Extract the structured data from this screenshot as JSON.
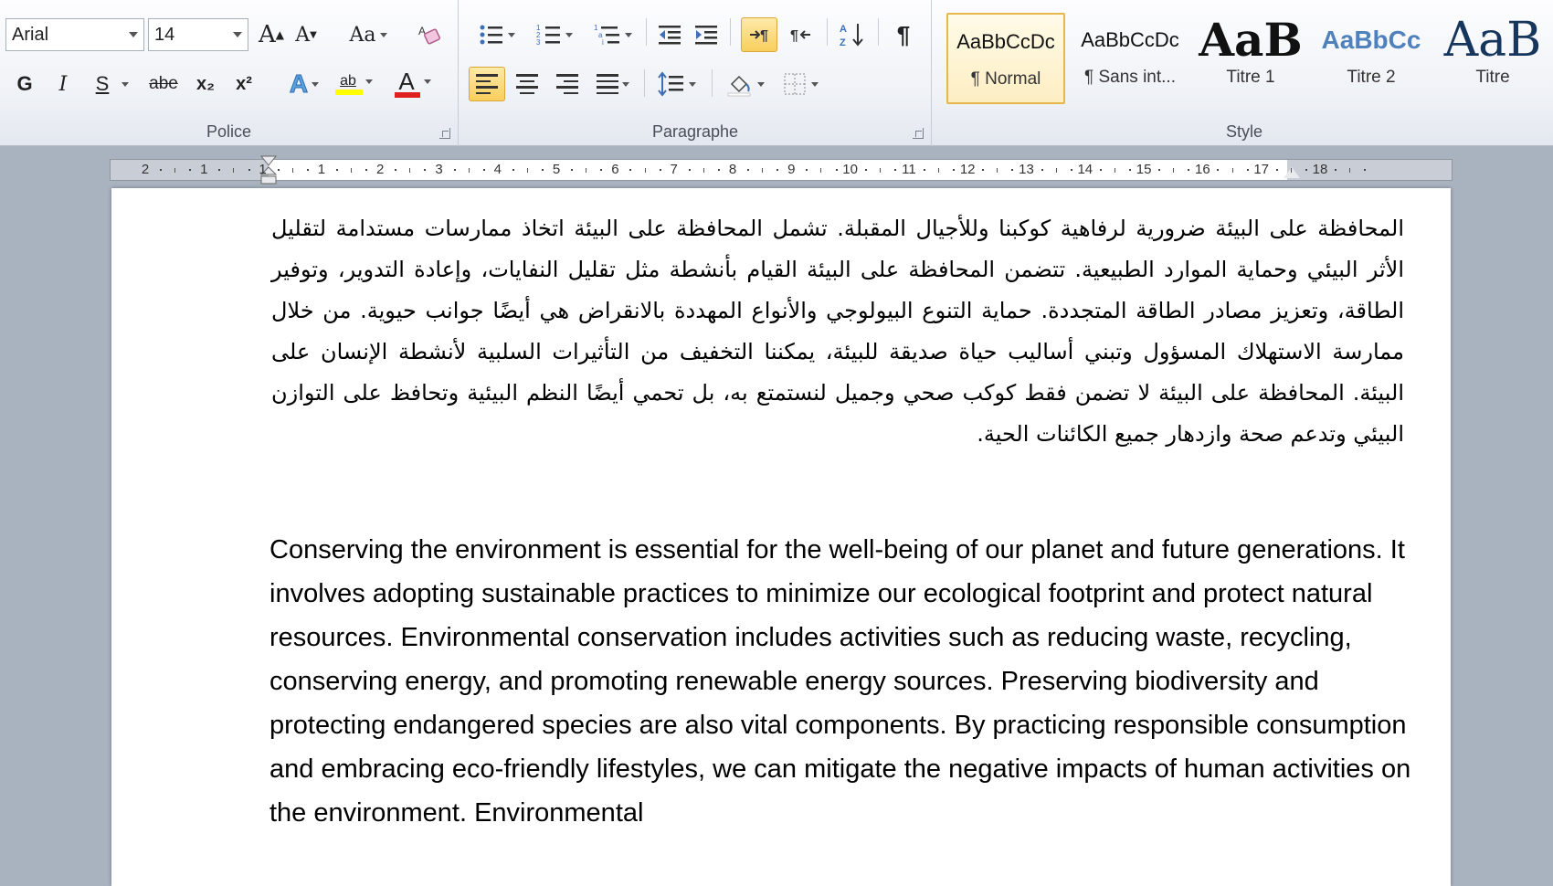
{
  "ribbon": {
    "font": {
      "group_label": "Police",
      "font_name": "Arial",
      "font_size": "14",
      "grow_label": "A",
      "shrink_label": "A",
      "case_label": "Aa",
      "bold": "G",
      "italic": "I",
      "underline": "S",
      "strike": "abe",
      "subscript": "x₂",
      "superscript": "x²",
      "effects": "A",
      "highlight": "ab",
      "font_color": "A",
      "colors": {
        "highlight": "#ffff00",
        "font_color": "#e02020"
      }
    },
    "paragraph": {
      "group_label": "Paragraphe"
    },
    "styles": {
      "group_label": "Style",
      "items": [
        {
          "sample": "AaBbCcDc",
          "name": "¶ Normal"
        },
        {
          "sample": "AaBbCcDc",
          "name": "¶ Sans int..."
        },
        {
          "sample": "AaB",
          "name": "Titre 1"
        },
        {
          "sample": "AaBbCc",
          "name": "Titre 2"
        },
        {
          "sample": "AaB",
          "name": "Titre"
        }
      ]
    }
  },
  "ruler": {
    "numbers": [
      "2",
      "1",
      "1",
      "1",
      "2",
      "3",
      "4",
      "5",
      "6",
      "7",
      "8",
      "9",
      "10",
      "11",
      "12",
      "13",
      "14",
      "15",
      "16",
      "17",
      "18"
    ]
  },
  "document": {
    "arabic_paragraph": "المحافظة على البيئة ضرورية لرفاهية كوكبنا وللأجيال المقبلة. تشمل المحافظة على البيئة اتخاذ ممارسات مستدامة لتقليل الأثر البيئي وحماية الموارد الطبيعية. تتضمن المحافظة على البيئة القيام بأنشطة مثل تقليل النفايات، وإعادة التدوير، وتوفير الطاقة، وتعزيز مصادر الطاقة المتجددة. حماية التنوع البيولوجي والأنواع المهددة بالانقراض هي أيضًا جوانب حيوية. من خلال ممارسة الاستهلاك المسؤول وتبني أساليب حياة صديقة للبيئة، يمكننا التخفيف من التأثيرات السلبية لأنشطة الإنسان على البيئة. المحافظة على البيئة لا تضمن فقط كوكب صحي وجميل لنستمتع به، بل تحمي أيضًا النظم البيئية وتحافظ على التوازن البيئي وتدعم صحة وازدهار جميع الكائنات الحية.",
    "english_paragraph": "Conserving the environment is essential for the well-being of our planet and future generations. It involves adopting sustainable practices to minimize our ecological footprint and protect natural resources. Environmental conservation includes activities such as reducing waste, recycling, conserving energy, and promoting renewable energy sources. Preserving biodiversity and protecting endangered species are also vital components. By practicing responsible consumption and embracing eco-friendly lifestyles, we can mitigate the negative impacts of human activities on the environment. Environmental"
  }
}
